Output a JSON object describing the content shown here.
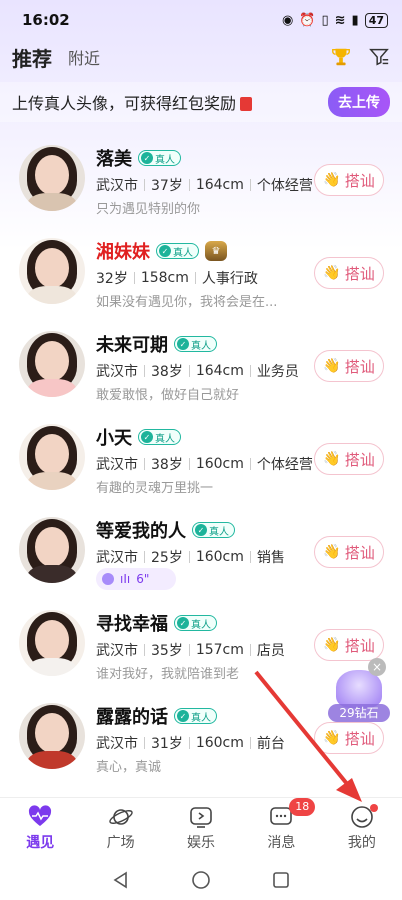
{
  "status_bar": {
    "time": "16:02",
    "battery": "47"
  },
  "top_nav": {
    "tab_recommend": "推荐",
    "tab_nearby": "附近"
  },
  "banner": {
    "text": "上传真人头像，可获得红包奖励",
    "button": "去上传"
  },
  "verified_label": "真人",
  "greet_label": "搭讪",
  "users": [
    {
      "name": "落美",
      "name_color": "#111111",
      "info": [
        "武汉市",
        "37岁",
        "164cm",
        "个体经营"
      ],
      "bio": "只为遇见特别的你",
      "shirt": "#d9c4b0"
    },
    {
      "name": "湘妹妹",
      "name_color": "#e02020",
      "info": [
        "32岁",
        "158cm",
        "人事行政"
      ],
      "bio": "如果没有遇见你，我将会是在...",
      "shirt": "#efe6dc"
    },
    {
      "name": "未来可期",
      "info": [
        "武汉市",
        "38岁",
        "164cm",
        "业务员"
      ],
      "bio": "敢爱敢恨，做好自己就好",
      "shirt": "#f7c6c6"
    },
    {
      "name": "小天",
      "info": [
        "武汉市",
        "38岁",
        "160cm",
        "个体经营"
      ],
      "bio": "有趣的灵魂万里挑一",
      "shirt": "#e9d2c0"
    },
    {
      "name": "等爱我的人",
      "info": [
        "武汉市",
        "25岁",
        "160cm",
        "销售"
      ],
      "voice": "6\"",
      "shirt": "#3a2c2a"
    },
    {
      "name": "寻找幸福",
      "info": [
        "武汉市",
        "35岁",
        "157cm",
        "店员"
      ],
      "bio": "谁对我好，我就陪谁到老",
      "shirt": "#f4f1ee"
    },
    {
      "name": "露露的话",
      "info": [
        "武汉市",
        "31岁",
        "160cm",
        "前台"
      ],
      "bio": "真心，真诚",
      "shirt": "#c0392b"
    }
  ],
  "gift_float": {
    "label": "29钻石"
  },
  "tabbar": {
    "items": [
      {
        "label": "遇见",
        "icon": "heart-pulse-icon"
      },
      {
        "label": "广场",
        "icon": "planet-icon"
      },
      {
        "label": "娱乐",
        "icon": "play-icon"
      },
      {
        "label": "消息",
        "icon": "message-icon",
        "badge": "18"
      },
      {
        "label": "我的",
        "icon": "smile-face-icon"
      }
    ]
  },
  "colors": {
    "accent": "#7c3aed",
    "badge_red": "#ef4444",
    "greet_text": "#e05a7a"
  }
}
